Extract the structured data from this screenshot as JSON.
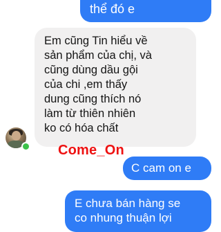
{
  "conversation": {
    "messages": [
      {
        "sender": "self",
        "lines": [
          "thể đó e"
        ]
      },
      {
        "sender": "contact",
        "lines": [
          "Em cũng Tin hiểu  về",
          "sản phẩm của  chị, và",
          "cũng dùng  dầu gội",
          "của  chi  ,em  thấy",
          "dung cũng  thích nó",
          "làm  từ  thiên nhiên",
          "ko có hóa chất"
        ]
      },
      {
        "sender": "self",
        "lines": [
          "C cam on e"
        ]
      },
      {
        "sender": "self",
        "lines": [
          "E chưa bán hàng se",
          "co nhung thuận lợi"
        ]
      }
    ],
    "watermark": "Come_On",
    "colors": {
      "sent_bubble": "#2f7cf6",
      "received_bubble": "#f1f0f0",
      "watermark": "#ee1111",
      "online_status": "#3cc24a"
    },
    "icons": [
      "contact-avatar",
      "online-status-dot"
    ]
  }
}
